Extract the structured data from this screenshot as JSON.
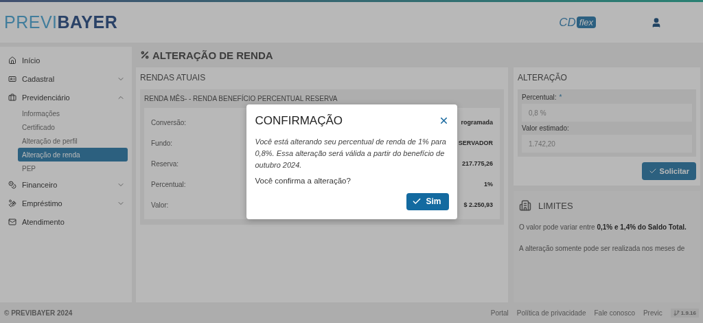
{
  "header": {
    "logo": [
      {
        "text": "PREVI",
        "kind": "light"
      },
      {
        "text": "BAYER",
        "kind": "bold"
      }
    ],
    "plan_badge": {
      "left": "CD",
      "right": "flex"
    }
  },
  "sidebar": {
    "items": [
      {
        "label": "Início",
        "selected": false
      },
      {
        "label": "Cadastral",
        "expanded": false,
        "selected": false
      },
      {
        "label": "Previdenciário",
        "expanded": true,
        "selected": false,
        "children": [
          {
            "label": "Informações",
            "selected": false
          },
          {
            "label": "Certificado",
            "selected": false
          },
          {
            "label": "Alteração de perfil",
            "selected": false
          },
          {
            "label": "Alteração de renda",
            "selected": true
          },
          {
            "label": "PEP",
            "selected": false
          }
        ]
      },
      {
        "label": "Financeiro",
        "expanded": false,
        "selected": false
      },
      {
        "label": "Empréstimo",
        "expanded": false,
        "selected": false
      },
      {
        "label": "Atendimento",
        "selected": false
      }
    ]
  },
  "page_title": "ALTERAÇÃO DE RENDA",
  "rendas": {
    "title": "RENDAS ATUAIS",
    "subtitle": "RENDA MÊS- - RENDA BENEFÍCIO PERCENTUAL RESERVA",
    "rows": [
      {
        "label": "Conversão:",
        "value": "rogramada"
      },
      {
        "label": "Fundo:",
        "value": "SERVADOR"
      },
      {
        "label": "Reserva:",
        "value": "217.775,26"
      },
      {
        "label": "Percentual:",
        "value": "1%"
      },
      {
        "label": "Valor:",
        "value": "$ 2.250,93"
      }
    ]
  },
  "alteracao": {
    "title": "ALTERAÇÃO",
    "fields": [
      {
        "label": "Percentual:",
        "required_mark": "*",
        "value": "0,8 %"
      },
      {
        "label": "Valor estimado:",
        "value": "1.742,20"
      }
    ],
    "submit": "Solicitar"
  },
  "limites": {
    "title": "LIMITES",
    "paragraphs": [
      "O valor pode variar entre **0,1% e 1,4% do Saldo Total.**",
      "A alteração somente pode ser realizada nos meses de"
    ]
  },
  "footer": {
    "copyright": "© PREVIBAYER 2024",
    "links": [
      "Portal",
      "Política de privacidade",
      "Fale conosco",
      "Previc"
    ],
    "version": "1.9.16"
  },
  "modal": {
    "title": "CONFIRMAÇÃO",
    "message": "Você está alterando seu percentual de renda de 1% para 0,8%. Essa alteração será válida a partir do benefício de outubro 2024.",
    "question": "Você confirma a alteração?",
    "confirm": "Sim"
  }
}
